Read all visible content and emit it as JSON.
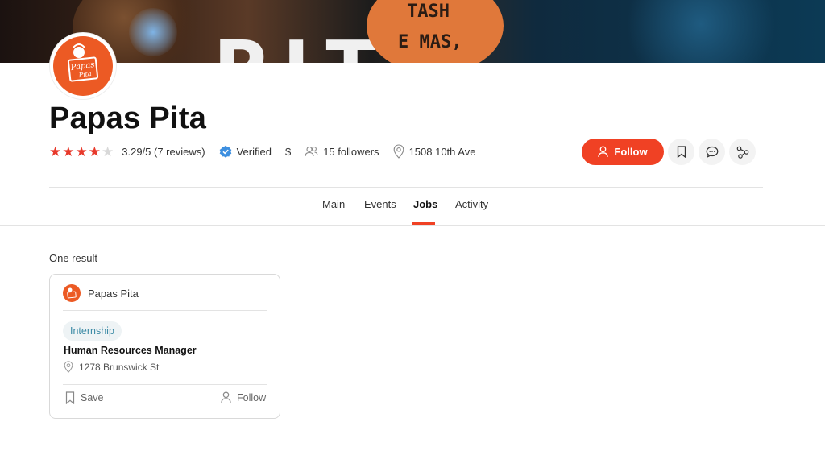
{
  "business": {
    "name": "Papas Pita",
    "logo_text": "Papas Pita",
    "rating_stars": 4,
    "rating_text": "3.29/5 (7 reviews)",
    "verified_label": "Verified",
    "price": "$",
    "followers": "15 followers",
    "address": "1508 10th Ave"
  },
  "banner": {
    "sign_line1": "TASH",
    "sign_line2": "E MAS,",
    "letters": "PITA"
  },
  "actions": {
    "follow_label": "Follow",
    "icons": [
      "bookmark-icon",
      "message-icon",
      "share-icon"
    ]
  },
  "tabs": [
    {
      "label": "Main"
    },
    {
      "label": "Events"
    },
    {
      "label": "Jobs"
    },
    {
      "label": "Activity"
    }
  ],
  "active_tab": "Jobs",
  "results": {
    "count_text": "One result"
  },
  "job_card": {
    "company": "Papas Pita",
    "badge": "Internship",
    "title": "Human Resources Manager",
    "location": "1278 Brunswick St",
    "save_label": "Save",
    "follow_label": "Follow"
  },
  "colors": {
    "accent": "#f04124",
    "star": "#e8392b",
    "logo_bg": "#ec5a24",
    "badge_text": "#3b8aa5",
    "verified": "#3d8fe0"
  }
}
